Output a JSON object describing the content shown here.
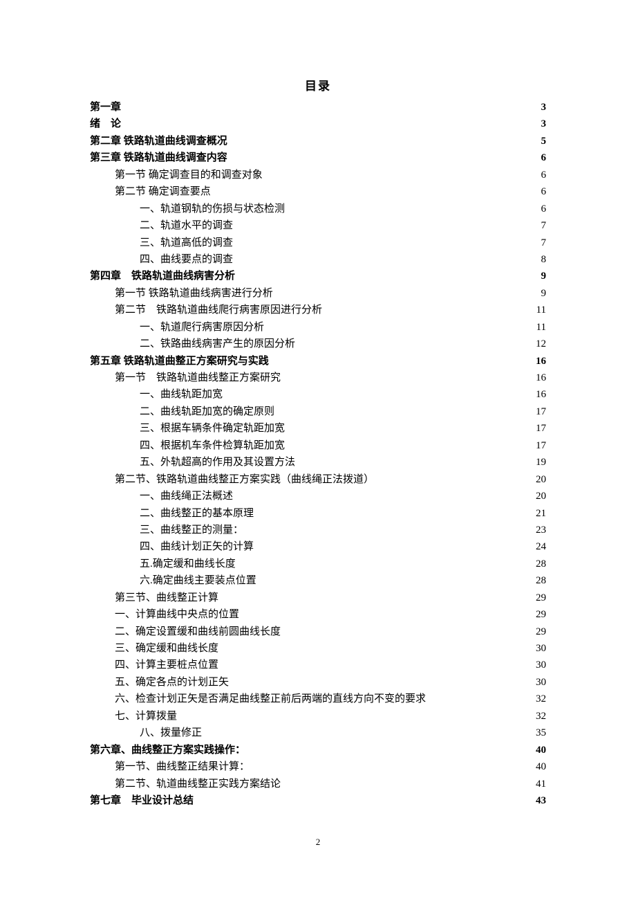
{
  "title": "目录",
  "page_number": "2",
  "entries": [
    {
      "level": "l0",
      "label": "第一章",
      "page": "3"
    },
    {
      "level": "l0",
      "label": "绪　论",
      "page": "3"
    },
    {
      "level": "l0",
      "label": "第二章 铁路轨道曲线调查概况",
      "page": "5"
    },
    {
      "level": "l0",
      "label": "第三章 铁路轨道曲线调查内容",
      "page": "6"
    },
    {
      "level": "l1",
      "label": "第一节 确定调查目的和调查对象",
      "page": "6"
    },
    {
      "level": "l1",
      "label": "第二节 确定调查要点",
      "page": "6"
    },
    {
      "level": "l2",
      "label": "一、轨道钢轨的伤损与状态检测",
      "page": "6"
    },
    {
      "level": "l2",
      "label": "二、轨道水平的调查",
      "page": "7"
    },
    {
      "level": "l2",
      "label": "三、轨道高低的调查",
      "page": "7"
    },
    {
      "level": "l2",
      "label": "四、曲线要点的调查",
      "page": "8"
    },
    {
      "level": "l0",
      "label": "第四章　铁路轨道曲线病害分析",
      "page": "9"
    },
    {
      "level": "l1",
      "label": "第一节 铁路轨道曲线病害进行分析",
      "page": "9"
    },
    {
      "level": "l1",
      "label": "第二节　铁路轨道曲线爬行病害原因进行分析",
      "page": "11"
    },
    {
      "level": "l2",
      "label": "一、轨道爬行病害原因分析",
      "page": "11"
    },
    {
      "level": "l2",
      "label": "二、铁路曲线病害产生的原因分析",
      "page": "12"
    },
    {
      "level": "l0",
      "label": "第五章 铁路轨道曲整正方案研究与实践",
      "page": "16"
    },
    {
      "level": "l1",
      "label": "第一节　铁路轨道曲线整正方案研究",
      "page": "16"
    },
    {
      "level": "l2",
      "label": "一、曲线轨距加宽",
      "page": "16"
    },
    {
      "level": "l2",
      "label": "二、曲线轨距加宽的确定原则",
      "page": "17"
    },
    {
      "level": "l2",
      "label": "三、根据车辆条件确定轨距加宽",
      "page": "17"
    },
    {
      "level": "l2",
      "label": "四、根据机车条件检算轨距加宽",
      "page": "17"
    },
    {
      "level": "l2",
      "label": "五、外轨超高的作用及其设置方法",
      "page": "19"
    },
    {
      "level": "l1",
      "label": "第二节、铁路轨道曲线整正方案实践（曲线绳正法拨道）",
      "page": "20"
    },
    {
      "level": "l2",
      "label": "一、曲线绳正法概述",
      "page": "20"
    },
    {
      "level": "l2",
      "label": "二、曲线整正的基本原理",
      "page": "21"
    },
    {
      "level": "l2",
      "label": "三、曲线整正的测量：",
      "page": "23"
    },
    {
      "level": "l2",
      "label": "四、曲线计划正矢的计算",
      "page": "24"
    },
    {
      "level": "l2",
      "label": "五.确定缓和曲线长度",
      "page": "28"
    },
    {
      "level": "l2",
      "label": "六.确定曲线主要装点位置",
      "page": "28"
    },
    {
      "level": "l1",
      "label": "第三节、曲线整正计算",
      "page": "29"
    },
    {
      "level": "l1b",
      "label": "一、计算曲线中央点的位置",
      "page": "29"
    },
    {
      "level": "l1b",
      "label": "二、确定设置缓和曲线前圆曲线长度",
      "page": "29"
    },
    {
      "level": "l1b",
      "label": "三、确定缓和曲线长度",
      "page": "30"
    },
    {
      "level": "l1b",
      "label": "四、计算主要桩点位置",
      "page": "30"
    },
    {
      "level": "l1b",
      "label": "五、确定各点的计划正矢",
      "page": "30"
    },
    {
      "level": "l1b",
      "label": "六、检查计划正矢是否满足曲线整正前后两端的直线方向不变的要求",
      "page": "32"
    },
    {
      "level": "l1b",
      "label": "七、计算拨量",
      "page": "32"
    },
    {
      "level": "l2",
      "label": "八、拨量修正",
      "page": "35"
    },
    {
      "level": "l0",
      "label": "第六章、曲线整正方案实践操作：",
      "page": "40"
    },
    {
      "level": "l1",
      "label": "第一节、曲线整正结果计算：",
      "page": "40"
    },
    {
      "level": "l1",
      "label": "第二节、轨道曲线整正实践方案结论",
      "page": "41"
    },
    {
      "level": "l0",
      "label": "第七章　毕业设计总结",
      "page": "43"
    }
  ]
}
